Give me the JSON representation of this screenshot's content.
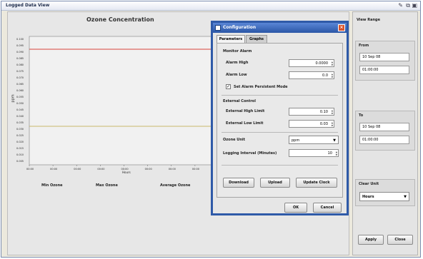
{
  "window": {
    "title": "Logged Data View"
  },
  "chart": {
    "title": "Ozone Concentration",
    "y_ticks": [
      "0.100",
      "0.095",
      "0.090",
      "0.085",
      "0.080",
      "0.075",
      "0.070",
      "0.065",
      "0.060",
      "0.055",
      "0.050",
      "0.045",
      "0.040",
      "0.035",
      "0.030",
      "0.025",
      "0.020",
      "0.015",
      "0.010",
      "0.005"
    ],
    "ylabel": "ppm",
    "x_ticks": [
      "00:00",
      "00:00",
      "00:00",
      "00:00",
      "00:00",
      "00:00",
      "00:00",
      "00:00",
      "00:00"
    ],
    "xlabel": "Hours",
    "stats": {
      "min": "Min Ozone",
      "max": "Max Ozone",
      "avg": "Average Ozone"
    }
  },
  "chart_data": {
    "type": "line",
    "title": "Ozone Concentration",
    "ylim": [
      0.0,
      0.1
    ],
    "series": [
      {
        "values": [
          0.09,
          0.09
        ]
      },
      {
        "values": [
          0.03,
          0.03
        ]
      }
    ],
    "colors": [
      "#d9443a",
      "#c9b86a"
    ]
  },
  "view_range": {
    "title": "View Range",
    "from_label": "From",
    "from_date": "10 Sep 08",
    "from_time": "01:00:00",
    "to_label": "To",
    "to_date": "10 Sep 08",
    "to_time": "01:00:00",
    "clear_unit_label": "Clear Unit",
    "clear_unit_value": "Hours",
    "apply": "Apply",
    "close": "Close"
  },
  "dialog": {
    "title": "Configuration",
    "tabs": [
      "Parameters",
      "Graphs"
    ],
    "monitor_alarm": {
      "heading": "Monitor Alarm",
      "alarm_high_label": "Alarm High",
      "alarm_high_value": "0.0000",
      "alarm_low_label": "Alarm Low",
      "alarm_low_value": "0.0",
      "persistent_label": "Set Alarm Persistent Mode",
      "persistent_checked": "✓"
    },
    "external_control": {
      "heading": "External Control",
      "high_label": "External High Limit",
      "high_value": "0.10",
      "low_label": "External Low Limit",
      "low_value": "0.03"
    },
    "ozone_unit_label": "Ozone Unit",
    "ozone_unit_value": "ppm",
    "logging_label": "Logging Interval (Minutes)",
    "logging_value": "10",
    "buttons": {
      "download": "Download",
      "upload": "Upload",
      "update_clock": "Update Clock"
    },
    "ok": "OK",
    "cancel": "Cancel"
  }
}
